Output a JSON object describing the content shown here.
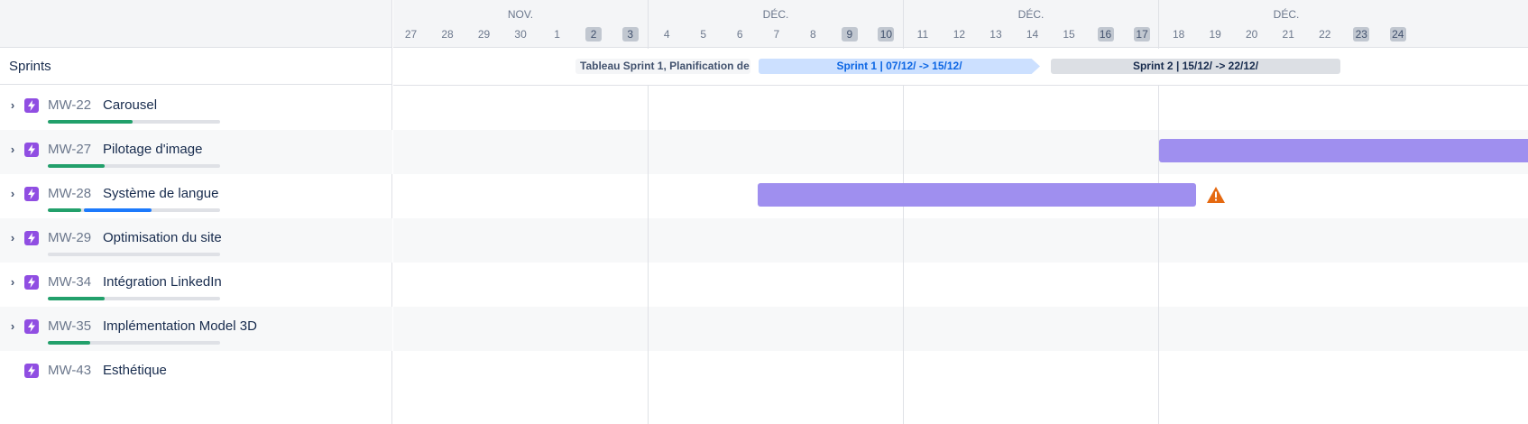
{
  "sidebar": {
    "sprints_label": "Sprints"
  },
  "issues": [
    {
      "key": "MW-22",
      "title": "Carousel",
      "done": 0.49,
      "in_progress": 0
    },
    {
      "key": "MW-27",
      "title": "Pilotage d'image",
      "done": 0.33,
      "in_progress": 0
    },
    {
      "key": "MW-28",
      "title": "Système de langue",
      "done": 0.2,
      "in_progress": 0.4
    },
    {
      "key": "MW-29",
      "title": "Optimisation du site",
      "done": 0,
      "in_progress": 0
    },
    {
      "key": "MW-34",
      "title": "Intégration LinkedIn",
      "done": 0.33,
      "in_progress": 0
    },
    {
      "key": "MW-35",
      "title": "Implémentation Model 3D",
      "done": 0.25,
      "in_progress": 0
    },
    {
      "key": "MW-43",
      "title": "Esthétique",
      "done": null,
      "in_progress": null
    }
  ],
  "timeline": {
    "months": [
      "NOV.",
      "DÉC.",
      "DÉC.",
      "DÉC."
    ],
    "days": [
      "27",
      "28",
      "29",
      "30",
      "1",
      "2",
      "3",
      "4",
      "5",
      "6",
      "7",
      "8",
      "9",
      "10",
      "11",
      "12",
      "13",
      "14",
      "15",
      "16",
      "17",
      "18",
      "19",
      "20",
      "21",
      "22",
      "23",
      "24"
    ],
    "weekend_days": [
      "2",
      "3",
      "9",
      "10",
      "16",
      "17",
      "23",
      "24"
    ]
  },
  "sprints": {
    "tableau": "Tableau Sprint 1, Planification de",
    "sprint1": "Sprint 1 | 07/12/ -> 15/12/",
    "sprint2": "Sprint 2 | 15/12/ -> 22/12/"
  },
  "icons": {
    "row_toggle": "chevron-right-icon",
    "issue_type": "epic-lightning-icon",
    "conflict": "warning-icon"
  },
  "colors": {
    "epic": "#904ee2",
    "bar": "#9f8fef",
    "done": "#22a06b",
    "in_progress": "#1d7afc",
    "warning": "#e56910"
  }
}
